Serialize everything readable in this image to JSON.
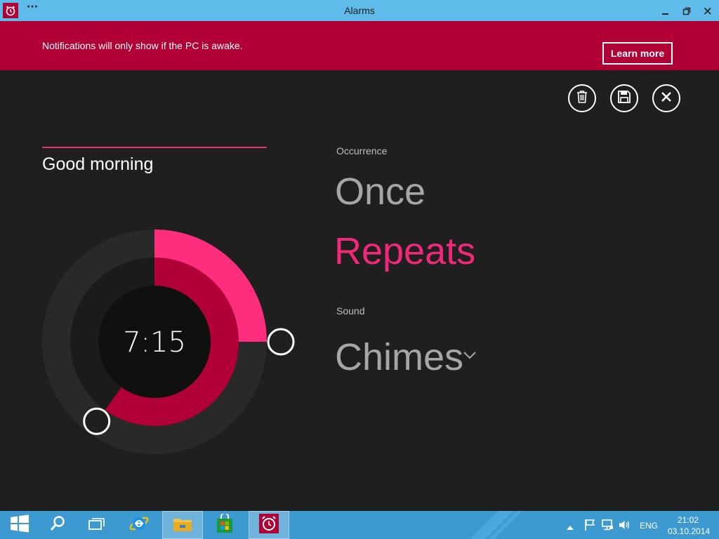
{
  "window": {
    "title": "Alarms",
    "menu_dots": "···",
    "icons": [
      "alarm-clock-icon",
      "minimize-icon",
      "restore-icon",
      "close-icon"
    ]
  },
  "banner": {
    "message": "Notifications will only show if the PC is awake.",
    "learn_more": "Learn more"
  },
  "commands": {
    "icons": [
      "trash-icon",
      "save-icon",
      "close-icon"
    ]
  },
  "alarm": {
    "name": "Good morning",
    "time": "7:15",
    "hour_fraction": 0.6,
    "minute_fraction": 0.25
  },
  "occurrence": {
    "label": "Occurrence",
    "options": [
      "Once",
      "Repeats"
    ],
    "selected": "Repeats"
  },
  "sound": {
    "label": "Sound",
    "value": "Chimes"
  },
  "taskbar": {
    "icons": [
      "windows-start-icon",
      "search-icon",
      "task-view-icon",
      "internet-explorer-icon",
      "file-explorer-icon",
      "store-icon",
      "alarms-app-icon"
    ],
    "tray_icons": [
      "chevron-up-icon",
      "flag-icon",
      "network-icon",
      "volume-icon"
    ],
    "language": "ENG",
    "clock_time": "21:02",
    "clock_date": "03.10.2014"
  },
  "colors": {
    "accent": "#b00036",
    "accent_bright": "#f0287a",
    "titlebar": "#5fbbea",
    "taskbar": "#3d9ad1",
    "background": "#1f1f1f"
  }
}
